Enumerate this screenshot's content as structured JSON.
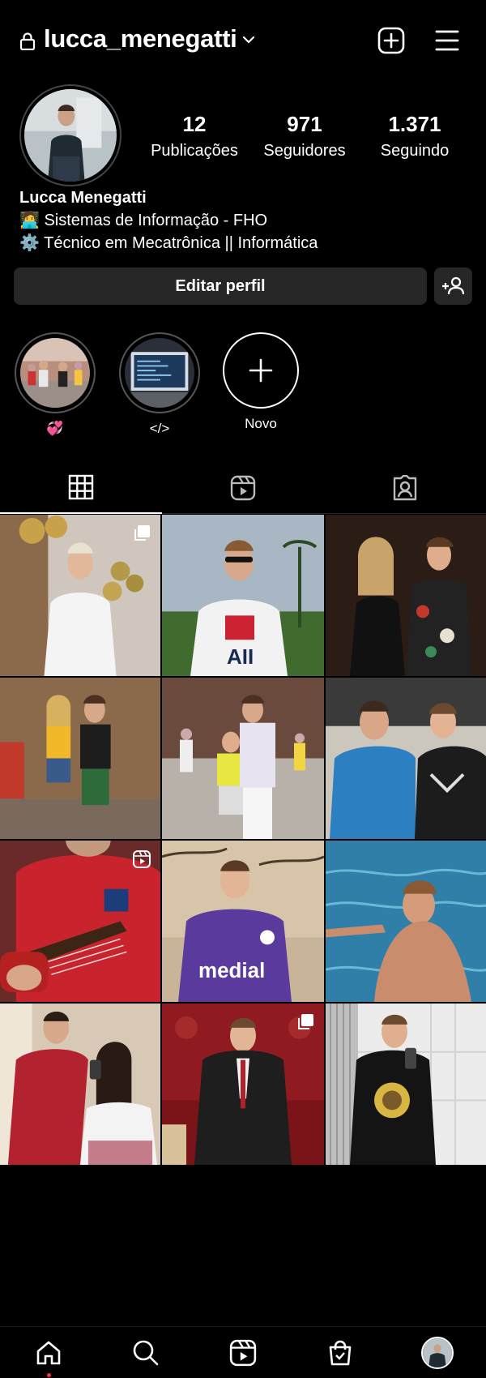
{
  "header": {
    "username": "lucca_menegatti",
    "icons": [
      "lock-icon",
      "chevron-down-icon",
      "add-post-icon",
      "menu-icon"
    ]
  },
  "profile": {
    "stats": [
      {
        "value": "12",
        "label": "Publicações"
      },
      {
        "value": "971",
        "label": "Seguidores"
      },
      {
        "value": "1.371",
        "label": "Seguindo"
      }
    ],
    "name": "Lucca Menegatti",
    "bio_lines": [
      "🧑‍💻 Sistemas de Informação - FHO",
      "⚙️ Técnico em Mecatrônica || Informática"
    ],
    "edit_button": "Editar perfil"
  },
  "highlights": [
    {
      "label": "💞"
    },
    {
      "label": "</>"
    },
    {
      "label": "Novo"
    }
  ],
  "tabs": [
    "grid-icon",
    "reels-icon",
    "tagged-icon"
  ],
  "grid": {
    "posts": [
      {
        "badge": "carousel"
      },
      {
        "badge": ""
      },
      {
        "badge": ""
      },
      {
        "badge": ""
      },
      {
        "badge": ""
      },
      {
        "badge": ""
      },
      {
        "badge": "reel"
      },
      {
        "badge": ""
      },
      {
        "badge": ""
      },
      {
        "badge": ""
      },
      {
        "badge": "carousel"
      },
      {
        "badge": ""
      }
    ]
  },
  "bottom_nav": [
    "home-icon",
    "search-icon",
    "reels-icon",
    "shop-icon",
    "profile-avatar"
  ],
  "colors": {
    "background": "#000000",
    "button": "#262626",
    "notification_dot": "#ff3040"
  }
}
